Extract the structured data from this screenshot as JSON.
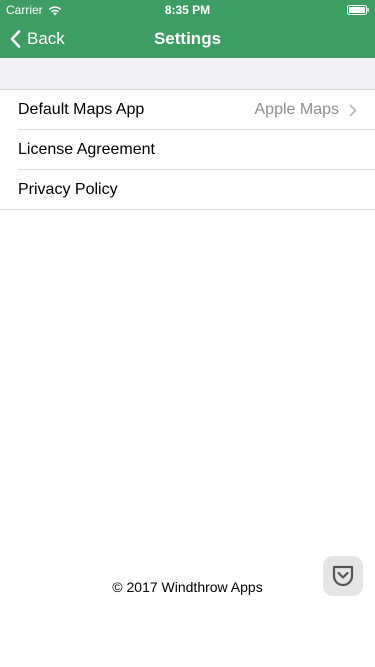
{
  "status_bar": {
    "carrier": "Carrier",
    "time": "8:35 PM",
    "icons": [
      "wifi-icon",
      "battery-icon"
    ]
  },
  "nav": {
    "back_label": "Back",
    "title": "Settings",
    "back_icon": "chevron-left-icon"
  },
  "settings": {
    "rows": [
      {
        "label": "Default Maps App",
        "value": "Apple Maps",
        "icon": "chevron-right-icon"
      },
      {
        "label": "License Agreement"
      },
      {
        "label": "Privacy Policy"
      }
    ]
  },
  "footer": {
    "copyright": "© 2017 Windthrow Apps"
  },
  "colors": {
    "accent": "#3d9d62",
    "secondary_text": "#8e8e93",
    "separator": "#dedee2",
    "group_background": "#f2f2f7"
  }
}
